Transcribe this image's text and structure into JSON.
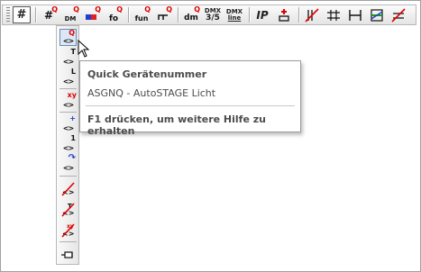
{
  "toolbar": {
    "buttons": [
      {
        "name": "device-number-button",
        "icon": "hash-icon",
        "label": "#"
      },
      {
        "name": "quick-device-number-button",
        "icon": "hash-q-icon",
        "label": "#",
        "sup": "Q"
      },
      {
        "name": "quick-dmx-button",
        "icon": "dmx-q-icon",
        "label": "DM",
        "sup": "Q"
      },
      {
        "name": "quick-color-button",
        "icon": "color-q-icon",
        "label": "",
        "sup": "Q"
      },
      {
        "name": "quick-focus-button",
        "icon": "focus-q-icon",
        "label": "fo",
        "sup": "Q"
      },
      {
        "name": "quick-function-button",
        "icon": "function-q-icon",
        "label": "fun",
        "sup": "Q"
      },
      {
        "name": "quick-circuit-button",
        "icon": "circuit-q-icon",
        "label": "",
        "sup": "Q"
      },
      {
        "name": "quick-dimmer-button",
        "icon": "dimmer-q-icon",
        "label": "dm",
        "sup": "Q"
      },
      {
        "name": "dmx-35-button",
        "icon": "dmx-35-icon",
        "label": "3/5",
        "top": "DMX"
      },
      {
        "name": "dmx-line-button",
        "icon": "dmx-line-icon",
        "label": "line",
        "top": "DMX"
      },
      {
        "name": "ip-button",
        "icon": "ip-icon",
        "label": "IP"
      },
      {
        "name": "add-connector-button",
        "icon": "add-connector-icon",
        "label": ""
      },
      {
        "name": "cable-strike-button",
        "icon": "cable-strike-icon",
        "label": ""
      },
      {
        "name": "cable-link-button",
        "icon": "cable-link-icon",
        "label": ""
      },
      {
        "name": "cable-join-button",
        "icon": "cable-join-icon",
        "label": ""
      },
      {
        "name": "cable-color-button",
        "icon": "cable-color-icon",
        "label": ""
      },
      {
        "name": "cable-remove-button",
        "icon": "cable-remove-icon",
        "label": ""
      }
    ]
  },
  "vertical_toolbar": {
    "buttons": [
      {
        "name": "quick-device-number-tool",
        "icon": "angle-q-icon",
        "sup": "Q",
        "active": true
      },
      {
        "name": "text-label-tool",
        "icon": "angle-t-icon",
        "sup": "T"
      },
      {
        "name": "line-label-tool",
        "icon": "angle-l-icon",
        "sup": "L"
      },
      {
        "name": "xy-label-tool",
        "icon": "angle-xy-icon",
        "sup": "xy"
      },
      {
        "name": "insert-label-tool",
        "icon": "angle-plus-icon",
        "sup": "+"
      },
      {
        "name": "number-one-tool",
        "icon": "angle-one-icon",
        "sup": "1"
      },
      {
        "name": "rotate-label-tool",
        "icon": "angle-rotate-icon",
        "sup": "↷"
      },
      {
        "name": "strike-label-tool",
        "icon": "strike-icon",
        "sup": ""
      },
      {
        "name": "strike-text-tool",
        "icon": "strike-t-icon",
        "sup": "T"
      },
      {
        "name": "strike-xy-tool",
        "icon": "strike-xy-icon",
        "sup": "xy"
      },
      {
        "name": "pin-tool",
        "icon": "pin-icon",
        "sup": ""
      }
    ]
  },
  "tooltip": {
    "title": "Quick Gerätenummer",
    "description": "ASGNQ - AutoSTAGE Licht",
    "help": "F1 drücken, um weitere Hilfe zu erhalten"
  },
  "colors": {
    "tooltip_text": "#4c4c4c",
    "accent_red": "#d00000",
    "active_border": "#6a8ab5"
  }
}
